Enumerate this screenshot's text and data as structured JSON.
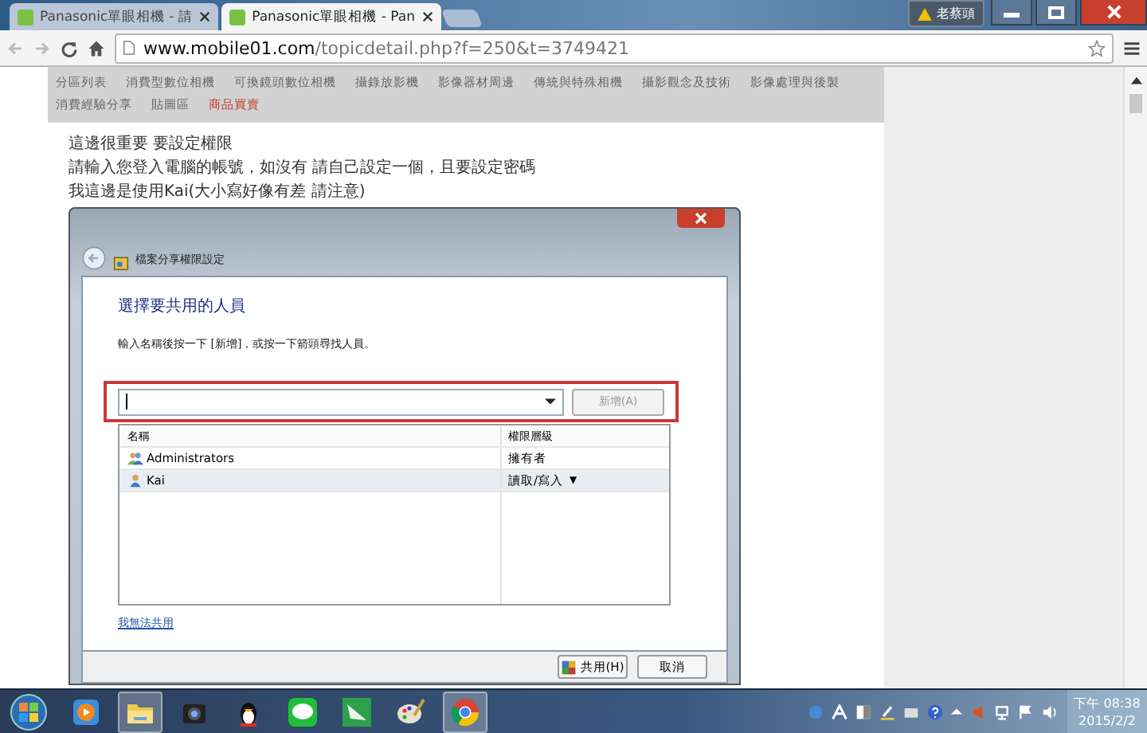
{
  "browser": {
    "tabs": [
      {
        "label": "Panasonic單眼相機 - 請",
        "selected": false
      },
      {
        "label": "Panasonic單眼相機 - Pan",
        "selected": true
      }
    ],
    "profile_badge": "老蔡頭",
    "address": {
      "host": "www.mobile01.com",
      "path": "/topicdetail.php?f=250&t=3749421"
    }
  },
  "nav_links": [
    {
      "label": "分區列表",
      "color": "#666666"
    },
    {
      "label": "消費型數位相機",
      "color": "#666666"
    },
    {
      "label": "可換鏡頭數位相機",
      "color": "#666666"
    },
    {
      "label": "攝錄放影機",
      "color": "#666666"
    },
    {
      "label": "影像器材周邊",
      "color": "#666666"
    },
    {
      "label": "傳統與特殊相機",
      "color": "#666666"
    },
    {
      "label": "攝影觀念及技術",
      "color": "#666666"
    },
    {
      "label": "影像處理與後製",
      "color": "#666666"
    },
    {
      "label": "消費經驗分享",
      "color": "#666666"
    },
    {
      "label": "貼圖區",
      "color": "#666666"
    },
    {
      "label": "商品買賣",
      "color": "#c0392b"
    }
  ],
  "post_lines": [
    "這邊很重要 要設定權限",
    "請輸入您登入電腦的帳號，如沒有 請自己設定一個，且要設定密碼",
    "我這邊是使用Kai(大小寫好像有差 請注意)"
  ],
  "dialog": {
    "title": "檔案分享權限設定",
    "heading": "選擇要共用的人員",
    "instruction": "輸入名稱後按一下 [新增]，或按一下箭頭尋找人員。",
    "add_button": {
      "label": "新增(A)",
      "disabled": true
    },
    "columns": [
      "名稱",
      "權限層級"
    ],
    "rows": [
      {
        "name": "Administrators",
        "permission": "擁有者",
        "kind": "group",
        "selected": false,
        "has_menu": false
      },
      {
        "name": "Kai",
        "permission": "讀取/寫入",
        "kind": "user",
        "selected": true,
        "has_menu": true
      }
    ],
    "menu_arrow": "▼",
    "help_link": "我無法共用",
    "buttons": [
      "共用(H)",
      "取消"
    ]
  },
  "taskbar": {
    "apps": [
      {
        "kind": "media",
        "active": false
      },
      {
        "kind": "folder",
        "active": true
      },
      {
        "kind": "camera",
        "active": false
      },
      {
        "kind": "penguin",
        "active": false
      },
      {
        "kind": "chat",
        "active": false
      },
      {
        "kind": "leaf",
        "active": false
      },
      {
        "kind": "palette",
        "active": false
      },
      {
        "kind": "browser",
        "active": true
      }
    ],
    "time": "下午 08:38",
    "date": "2015/2/2"
  }
}
